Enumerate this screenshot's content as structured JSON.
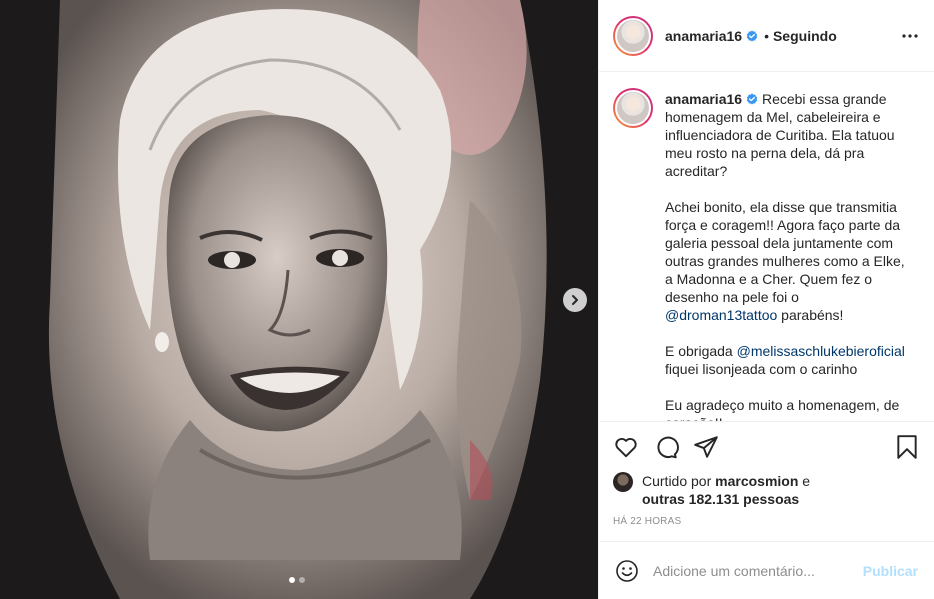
{
  "post": {
    "username": "anamaria16",
    "follow_status": "Seguindo",
    "separator": "•"
  },
  "caption": {
    "username": "anamaria16",
    "paragraph_1": "Recebi essa grande homenagem da Mel, cabeleireira e influenciadora de Curitiba. Ela tatuou meu rosto na perna dela, dá pra acreditar?",
    "paragraph_2_text": "Achei bonito, ela disse que transmitia força e coragem!! Agora faço parte da galeria pessoal dela juntamente com outras grandes mulheres como a Elke, a Madonna e a Cher. Quem fez o desenho na pele foi o",
    "paragraph_2_mention": "@droman13tattoo",
    "paragraph_2_end": "parabéns!",
    "paragraph_3_start": "E obrigada",
    "paragraph_3_mention": "@melissaschlukebieroficial",
    "paragraph_3_end": "fiquei lisonjeada com o carinho",
    "paragraph_4": "Eu agradeço muito a homenagem, de coração!!"
  },
  "likes": {
    "prefix": "Curtido por",
    "user": "marcosmion",
    "connector": "e",
    "others": "outras 182.131 pessoas"
  },
  "timestamp": "HÁ 22 HORAS",
  "comment_box": {
    "placeholder": "Adicione um comentário...",
    "publish_label": "Publicar"
  },
  "carousel": {
    "total_slides": 2,
    "active_slide": 1
  },
  "icons": {
    "verified": "verified-badge-icon",
    "more": "more-options-icon",
    "like": "heart-icon",
    "comment": "comment-icon",
    "share": "share-icon",
    "save": "bookmark-icon",
    "emoji": "emoji-icon",
    "next": "chevron-right-icon"
  },
  "colors": {
    "verified": "#3897f0",
    "link": "#00376b",
    "publish_disabled": "#b2dffc",
    "muted": "#8e8e8e"
  }
}
